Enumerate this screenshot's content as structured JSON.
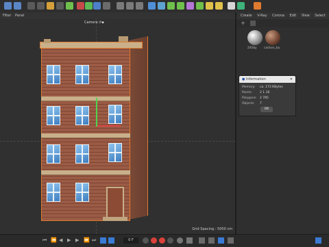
{
  "menu": {
    "filter": "Filter",
    "panel": "Panel"
  },
  "right_menu": [
    "Create",
    "V-Ray",
    "Corona",
    "Edit",
    "View",
    "Select"
  ],
  "viewport": {
    "camera_label": "Camera ⟳▪",
    "grid_spacing": "Grid Spacing : 5000 cm"
  },
  "materials": [
    {
      "name": "24Sky"
    },
    {
      "name": "carbon_bu"
    }
  ],
  "info_dialog": {
    "title": "Information",
    "rows": [
      {
        "label": "Memory:",
        "value": "ca. 173 KBytes"
      },
      {
        "label": "Points:",
        "value": "2 1 16"
      },
      {
        "label": "Polygons:",
        "value": "2 785"
      },
      {
        "label": "Objects:",
        "value": "7"
      }
    ],
    "ok": "OK"
  },
  "timeline": {
    "frame": "0 F"
  },
  "colors": {
    "accent_blue": "#3a7bd5",
    "record_red": "#d9413a",
    "bg": "#2b2b2b"
  }
}
